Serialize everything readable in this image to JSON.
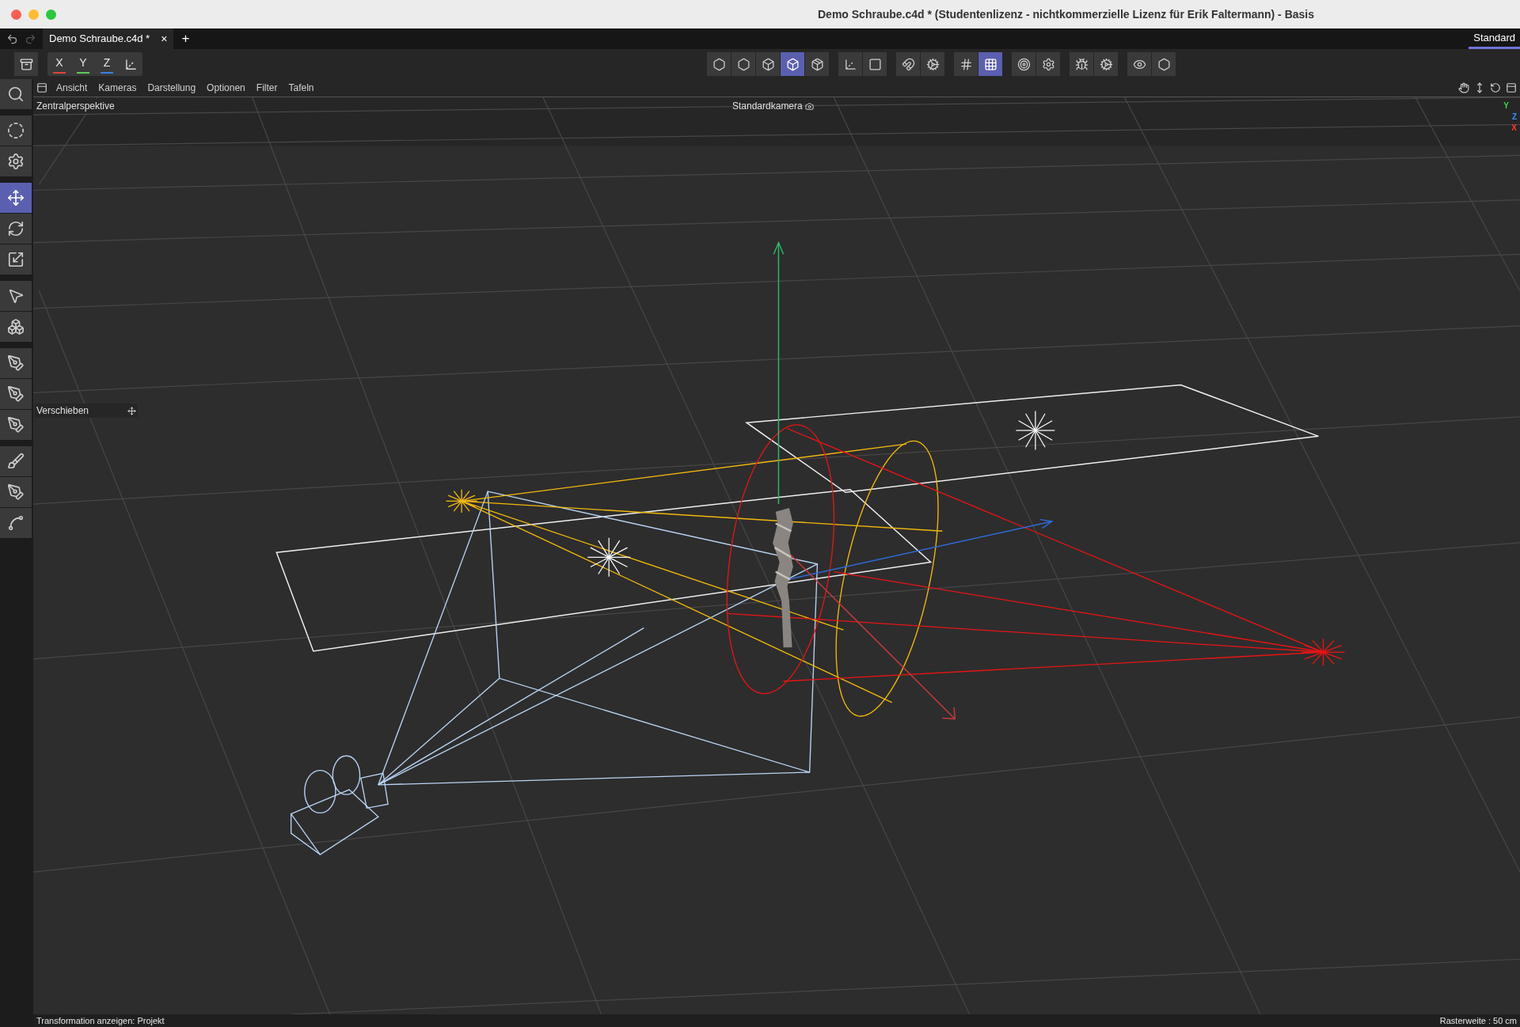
{
  "window": {
    "title": "Demo Schraube.c4d * (Studentenlizenz - nichtkommerzielle Lizenz für Erik Faltermann) - Basis"
  },
  "tabs": [
    {
      "label": "Demo Schraube.c4d *",
      "selected": true,
      "close": "×"
    }
  ],
  "new_tab": "+",
  "layout_tab": {
    "label": "Standard",
    "selected": true
  },
  "axis_buttons": [
    {
      "label": "X",
      "color": "#e0453c"
    },
    {
      "label": "Y",
      "color": "#5ec95e"
    },
    {
      "label": "Z",
      "color": "#3c7fe0"
    }
  ],
  "toolbar_groups": [
    [
      {
        "selected": false
      },
      {
        "selected": false
      },
      {
        "selected": false
      },
      {
        "selected": true
      },
      {
        "selected": false
      }
    ],
    [
      {
        "selected": false
      },
      {
        "selected": false
      }
    ],
    [
      {
        "selected": false
      },
      {
        "selected": false
      }
    ],
    [
      {
        "selected": false
      },
      {
        "selected": true
      }
    ],
    [
      {
        "selected": false
      },
      {
        "selected": false
      }
    ],
    [
      {
        "selected": false
      },
      {
        "selected": false
      }
    ],
    [
      {
        "selected": false
      },
      {
        "selected": false
      }
    ]
  ],
  "left_tool_groups": [
    [
      {
        "selected": false
      }
    ],
    [
      {
        "selected": false
      },
      {
        "selected": false
      }
    ],
    [
      {
        "selected": true
      },
      {
        "selected": false
      },
      {
        "selected": false
      }
    ],
    [
      {
        "selected": false
      },
      {
        "selected": false
      }
    ],
    [
      {
        "selected": false
      },
      {
        "selected": false
      },
      {
        "selected": false
      }
    ],
    [
      {
        "selected": false
      },
      {
        "selected": false
      },
      {
        "selected": false
      }
    ]
  ],
  "view_menu": [
    "Ansicht",
    "Kameras",
    "Darstellung",
    "Optionen",
    "Filter",
    "Tafeln"
  ],
  "viewport": {
    "projection": "Zentralperspektive",
    "camera": "Standardkamera",
    "hud": "Verschieben",
    "gizmo": [
      {
        "label": "Y",
        "color": "#3ddc3d"
      },
      {
        "label": "Z",
        "color": "#3c8cff"
      },
      {
        "label": "X",
        "color": "#ff3b30"
      }
    ]
  },
  "status_bar": {
    "left": "Transformation anzeigen: Projekt",
    "right": "Rasterweite : 50 cm"
  }
}
